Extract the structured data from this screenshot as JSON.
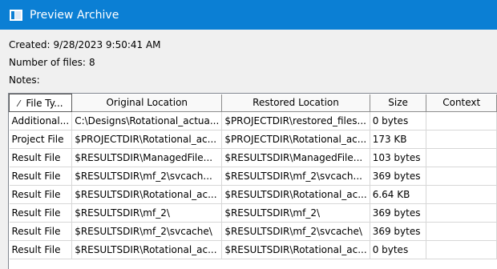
{
  "window": {
    "title": "Preview Archive",
    "titlebar_color": "#0b7fd4"
  },
  "info": {
    "created_label": "Created:",
    "created_value": "9/28/2023 9:50:41 AM",
    "files_label": "Number of files:",
    "files_value": "8",
    "notes_label": "Notes:"
  },
  "table": {
    "sort_indicator": "⁄",
    "columns": [
      "File Ty...",
      "Original Location",
      "Restored Location",
      "Size",
      "Context"
    ],
    "rows": [
      [
        "Additional...",
        "C:\\Designs\\Rotational_actua...",
        "$PROJECTDIR\\restored_files...",
        "0 bytes",
        ""
      ],
      [
        "Project File",
        "$PROJECTDIR\\Rotational_ac...",
        "$PROJECTDIR\\Rotational_ac...",
        "173 KB",
        ""
      ],
      [
        "Result File",
        "$RESULTSDIR\\ManagedFile...",
        "$RESULTSDIR\\ManagedFile...",
        "103 bytes",
        ""
      ],
      [
        "Result File",
        "$RESULTSDIR\\mf_2\\svcach...",
        "$RESULTSDIR\\mf_2\\svcach...",
        "369 bytes",
        ""
      ],
      [
        "Result File",
        "$RESULTSDIR\\Rotational_ac...",
        "$RESULTSDIR\\Rotational_ac...",
        "6.64 KB",
        ""
      ],
      [
        "Result File",
        "$RESULTSDIR\\mf_2\\",
        "$RESULTSDIR\\mf_2\\",
        "369 bytes",
        ""
      ],
      [
        "Result File",
        "$RESULTSDIR\\mf_2\\svcache\\",
        "$RESULTSDIR\\mf_2\\svcache\\",
        "369 bytes",
        ""
      ],
      [
        "Result File",
        "$RESULTSDIR\\Rotational_ac...",
        "$RESULTSDIR\\Rotational_ac...",
        "0 bytes",
        ""
      ]
    ]
  }
}
